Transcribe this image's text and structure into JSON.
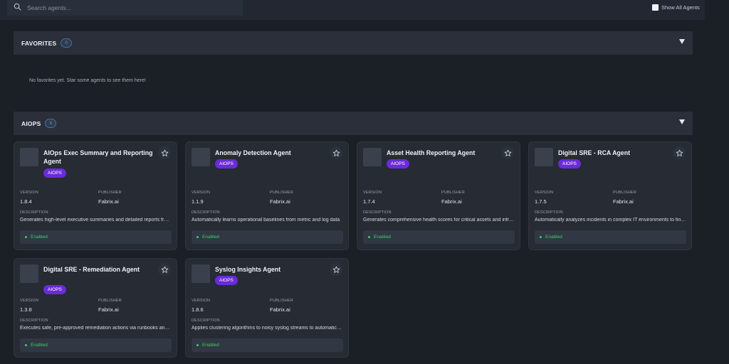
{
  "search": {
    "placeholder": "Search agents..."
  },
  "toolbar": {
    "show_all_label": "Show All Agents"
  },
  "favorites": {
    "title": "FAVORITES",
    "count": "0",
    "empty_message": "No favorites yet. Star some agents to see them here!"
  },
  "aiops": {
    "title": "AIOPS",
    "count": "6"
  },
  "labels": {
    "version": "VERSION",
    "publisher": "PUBLISHER",
    "description": "DESCRIPTION"
  },
  "agents": [
    {
      "name": "AIOps Exec Summary and Reporting Agent",
      "tag": "AIOPS",
      "version": "1.8.4",
      "publisher": "Fabrix.ai",
      "description": "Generates high-level executive summaries and detailed reports from AIOps data",
      "status": "Enabled"
    },
    {
      "name": "Anomaly Detection Agent",
      "tag": "AIOPS",
      "version": "1.1.9",
      "publisher": "Fabrix.ai",
      "description": "Automatically learns operational baselines from metric and log data",
      "status": "Enabled"
    },
    {
      "name": "Asset Health Reporting Agent",
      "tag": "AIOPS",
      "version": "1.7.4",
      "publisher": "Fabrix.ai",
      "description": "Generates comprehensive health scores for critical assets and infrastructure",
      "status": "Enabled"
    },
    {
      "name": "Digital SRE - RCA Agent",
      "tag": "AIOPS",
      "version": "1.7.5",
      "publisher": "Fabrix.ai",
      "description": "Automatically analyzes incidents in complex IT environments to find root causes",
      "status": "Enabled"
    },
    {
      "name": "Digital SRE - Remediation Agent",
      "tag": "AIOPS",
      "version": "1.3.8",
      "publisher": "Fabrix.ai",
      "description": "Executes safe, pre-approved remediation actions via runbooks and automation",
      "status": "Enabled"
    },
    {
      "name": "Syslog Insights Agent",
      "tag": "AIOPS",
      "version": "1.8.6",
      "publisher": "Fabrix.ai",
      "description": "Applies clustering algorithms to noisy syslog streams to automatically detect patterns",
      "status": "Enabled"
    }
  ],
  "icons": {
    "search": "search-icon",
    "star": "star-icon",
    "caret": "chevron-down-icon"
  },
  "colors": {
    "tag": "#6a2bd9",
    "enabled": "#3ccf6a",
    "count_badge": "#4a6fa0"
  }
}
